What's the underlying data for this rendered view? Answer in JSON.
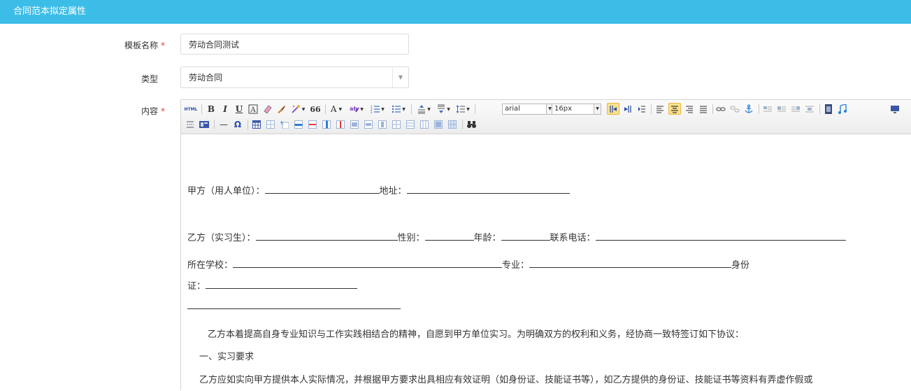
{
  "window": {
    "title": "合同范本拟定属性"
  },
  "form": {
    "template_name": {
      "label": "模板名称",
      "required_mark": "*",
      "value": "劳动合同测试"
    },
    "type": {
      "label": "类型",
      "value": "劳动合同",
      "arrow": "▼"
    },
    "content": {
      "label": "内容",
      "required_mark": "*"
    }
  },
  "toolbar": {
    "html_label": "HTML",
    "bold": "B",
    "italic": "I",
    "underline": "U",
    "font_color": "A",
    "quote": "66",
    "omega": "Ω",
    "font_family": "arial",
    "font_size": "16px",
    "hr": "—"
  },
  "document": {
    "party_a": {
      "label": "甲方（用人单位）：",
      "address_label": "地址："
    },
    "party_b": {
      "label": "乙方（实习生）：",
      "gender_label": "性别：",
      "age_label": "年龄：",
      "phone_label": "联系电话："
    },
    "school": {
      "label": "所在学校：",
      "major_label": "专业：",
      "id_label_1": "身份"
    },
    "id_line": {
      "label": "证："
    },
    "intro": "乙方本着提高自身专业知识与工作实践相结合的精神，自愿到甲方单位实习。为明确双方的权利和义务，经协商一致特签订如下协议：",
    "section1_title": "一、实习要求",
    "section1_text": "乙方应如实向甲方提供本人实际情况，并根据甲方要求出具相应有效证明（如身份证、技能证书等），如乙方提供的身份证、技能证书等资料有弄虚作假或"
  },
  "colors": {
    "titlebar": "#3cbde8",
    "required": "#e4393c"
  }
}
